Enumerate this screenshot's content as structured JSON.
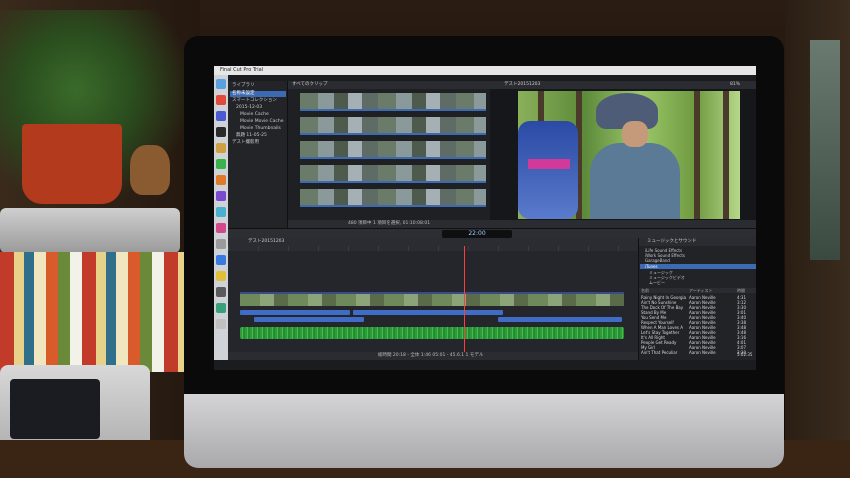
{
  "room": {
    "brand_logo": "apple-logo",
    "apple_glyph": ""
  },
  "app": {
    "menubar_title": "Final Cut Pro Trial",
    "library": {
      "title": "ライブラリ",
      "rows": [
        "名称未設定",
        "スマートコレクション",
        "2015-12-03",
        "Movie Cache",
        "Movie Movie Cache",
        "Movie Thumbnails",
        "無題 11-05-25",
        "デスト撮影用"
      ]
    },
    "browser": {
      "title": "すべてのクリップ",
      "footer": "480 項目中 1 項目を選択, 01:10:08:01"
    },
    "viewer": {
      "title": "デスト20151203",
      "zoom": "81%"
    },
    "toolbar": {
      "timecode": "22:00"
    },
    "timeline": {
      "title": "デスト20151203",
      "footer": "総時間 20:18 - 全体 1:46 05:01 - 45.6.1 1 モデル"
    },
    "music": {
      "title": "ミュージックとサウンド",
      "categories": [
        "iLife Sound Effects",
        "iWork Sound Effects",
        "GarageBand",
        "iTunes",
        "ミュージック",
        "ミュージックビデオ",
        "ムービー"
      ],
      "columns": [
        "名前",
        "アーティスト",
        "時間"
      ],
      "songs": [
        {
          "name": "Rainy Night In Georgia",
          "artist": "Aaron Neville",
          "time": "4:31"
        },
        {
          "name": "Ain't No Sunshine",
          "artist": "Aaron Neville",
          "time": "3:12"
        },
        {
          "name": "The Dock Of The Bay",
          "artist": "Aaron Neville",
          "time": "3:30"
        },
        {
          "name": "Stand By Me",
          "artist": "Aaron Neville",
          "time": "3:01"
        },
        {
          "name": "You Send Me",
          "artist": "Aaron Neville",
          "time": "3:40"
        },
        {
          "name": "Respect Yourself",
          "artist": "Aaron Neville",
          "time": "3:38"
        },
        {
          "name": "When A Man Loves A",
          "artist": "Aaron Neville",
          "time": "3:48"
        },
        {
          "name": "Let's Stay Together",
          "artist": "Aaron Neville",
          "time": "3:48"
        },
        {
          "name": "It's All Right",
          "artist": "Aaron Neville",
          "time": "3:16"
        },
        {
          "name": "People Get Ready",
          "artist": "Aaron Neville",
          "time": "4:01"
        },
        {
          "name": "My Girl",
          "artist": "Aaron Neville",
          "time": "3:07"
        },
        {
          "name": "Ain't That Peculiar",
          "artist": "Aaron Neville",
          "time": "3:30"
        }
      ],
      "footer": "5:02:35"
    }
  }
}
